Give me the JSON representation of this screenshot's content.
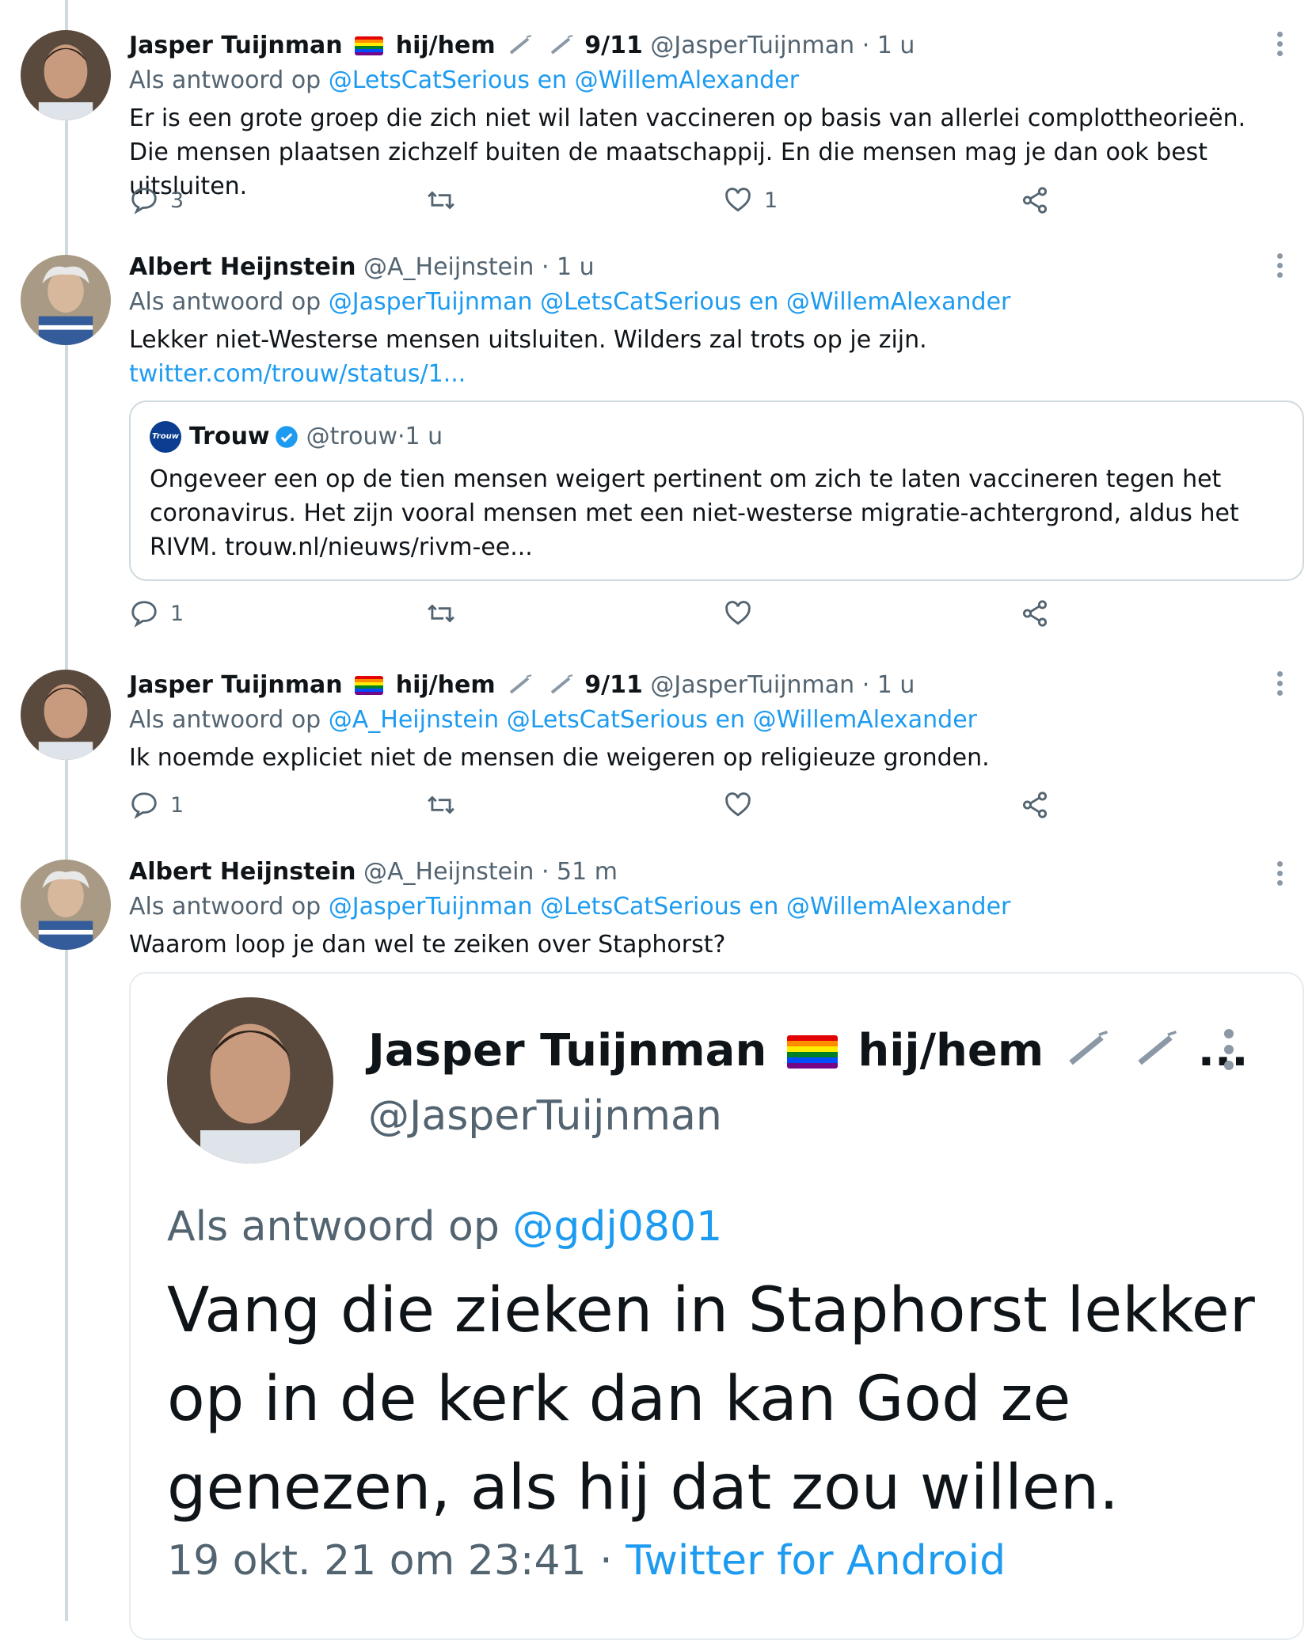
{
  "tweets": [
    {
      "name": "Jasper Tuijnman",
      "pronouns": "hij/hem",
      "extra": "9/11",
      "handle": "@JasperTuijnman",
      "time": "1 u",
      "reply_prefix": "Als antwoord op ",
      "reply_to": "@LetsCatSerious en @WillemAlexander",
      "text": "Er is een grote groep die zich niet wil laten vaccineren op basis van allerlei complottheorieën. Die mensen plaatsen zichzelf buiten de maatschappij. En die mensen mag je dan ook best uitsluiten.",
      "replies": "3",
      "likes": "1"
    },
    {
      "name": "Albert Heijnstein",
      "handle": "@A_Heijnstein",
      "time": "1 u",
      "reply_prefix": "Als antwoord op ",
      "reply_to": "@JasperTuijnman @LetsCatSerious en @WillemAlexander",
      "text": "Lekker niet-Westerse mensen uitsluiten. Wilders zal trots op je zijn.",
      "link": "twitter.com/trouw/status/1...",
      "quote": {
        "logo": "Trouw",
        "name": "Trouw",
        "handle": "@trouw",
        "time": "1 u",
        "text": "Ongeveer een op de tien mensen weigert pertinent om zich te laten vaccineren tegen het coronavirus. Het zijn vooral mensen met een niet-westerse migratie-achtergrond, aldus het RIVM. trouw.nl/nieuws/rivm-ee..."
      },
      "replies": "1",
      "likes": ""
    },
    {
      "name": "Jasper Tuijnman",
      "pronouns": "hij/hem",
      "extra": "9/11",
      "handle": "@JasperTuijnman",
      "time": "1 u",
      "reply_prefix": "Als antwoord op ",
      "reply_to": "@A_Heijnstein @LetsCatSerious en @WillemAlexander",
      "text": "Ik noemde expliciet niet de mensen die weigeren op religieuze gronden.",
      "replies": "1",
      "likes": ""
    },
    {
      "name": "Albert Heijnstein",
      "handle": "@A_Heijnstein",
      "time": "51 m",
      "reply_prefix": "Als antwoord op ",
      "reply_to": "@JasperTuijnman @LetsCatSerious en @WillemAlexander",
      "text": "Waarom loop je dan wel te zeiken over Staphorst?"
    }
  ],
  "screenshot": {
    "name": "Jasper Tuijnman",
    "pronouns": "hij/hem",
    "ellipsis": "...",
    "handle": "@JasperTuijnman",
    "reply_prefix": "Als antwoord op ",
    "reply_to": "@gdj0801",
    "text": "Vang die zieken in Staphorst lekker op in de kerk dan kan God ze genezen, als hij dat zou willen.",
    "date": "19 okt. 21 om 23:41",
    "separator": " · ",
    "source": "Twitter for Android"
  },
  "separator_dot": " · ",
  "colors": {
    "link": "#1d9bf0",
    "muted": "#536471",
    "verified": "#1d9bf0"
  },
  "icons": [
    "reply-icon",
    "retweet-icon",
    "like-icon",
    "share-icon",
    "more-icon",
    "verified-icon",
    "syringe-icon",
    "rainbow-flag-icon"
  ]
}
